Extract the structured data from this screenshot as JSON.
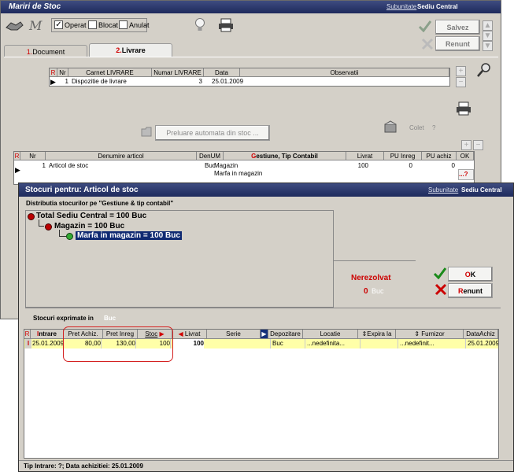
{
  "win1": {
    "title": "Mariri de Stoc",
    "subunit_label": "Subunitate",
    "subunit_value": "Sediu Central",
    "chk_operat": "Operat",
    "chk_blocat": "Blocat",
    "chk_anulat": "Anulat",
    "btn_save": "Salvez",
    "btn_cancel": "Renunt",
    "tab1_num": "1.",
    "tab1_label": "Document",
    "tab2_num": "2.",
    "tab2_label": "Livrare",
    "livrare_table": {
      "r": "R",
      "headers": [
        "Nr",
        "Carnet LIVRARE",
        "Numar LIVRARE",
        "Data",
        "Observatii"
      ],
      "row": [
        "1",
        "Dispozitie de livrare",
        "3",
        "25.01.2009",
        ""
      ]
    },
    "btn_preluare": "Preluare automata din stoc ...",
    "colet_label": "Colet",
    "colet_q": "?",
    "art_table": {
      "r": "R",
      "headers": [
        "Nr",
        "Denumire articol",
        "DenUM",
        "Gestiune, Tip Contabil",
        "Livrat",
        "PU Inreg",
        "PU achiz",
        "OK"
      ],
      "gestiune_g": "G",
      "gestiune_rest": "estiune, Tip Contabil",
      "row": [
        "1",
        "Articol de stoc",
        "Buc",
        "Magazin",
        "Marfa in magazin",
        "100",
        "0",
        "0",
        "...?"
      ]
    }
  },
  "win2": {
    "title": "Stocuri pentru: Articol de stoc",
    "subunit_label": "Subunitate",
    "subunit_value": "Sediu Central",
    "distrib_label": "Distributia stocurilor pe \"Gestiune & tip contabil\"",
    "tree": [
      "Total Sediu Central = 100 Buc",
      "Magazin = 100 Buc",
      "Marfa in magazin = 100 Buc"
    ],
    "nerezolvat_label": "Nerezolvat",
    "nerezolvat_value": "0",
    "nerezolvat_um": "Buc",
    "btn_ok_o": "O",
    "btn_ok_k": "K",
    "btn_renunt_r": "R",
    "btn_renunt_rest": "enunt",
    "stoc_expr_label": "Stocuri exprimate in",
    "stoc_expr_um": "Buc",
    "stock_table": {
      "r": "R",
      "intrare_i": "I",
      "intrare_rest": "ntrare",
      "headers": [
        "Pret Achiz.",
        "Pret Inreg",
        "Stoc",
        "Livrat",
        "Serie",
        "Depozitare",
        "Locatie",
        "Expira la",
        "Furnizor",
        "DataAchiz"
      ],
      "row_mark": "I",
      "row": [
        "25.01.2009",
        "80,00",
        "130,00",
        "100",
        "100",
        "",
        "Buc",
        "...nedefinita...",
        "",
        "...nedefinit...",
        "25.01.2009"
      ]
    },
    "status": "Tip Intrare: ?; Data achizitiei: 25.01.2009"
  }
}
